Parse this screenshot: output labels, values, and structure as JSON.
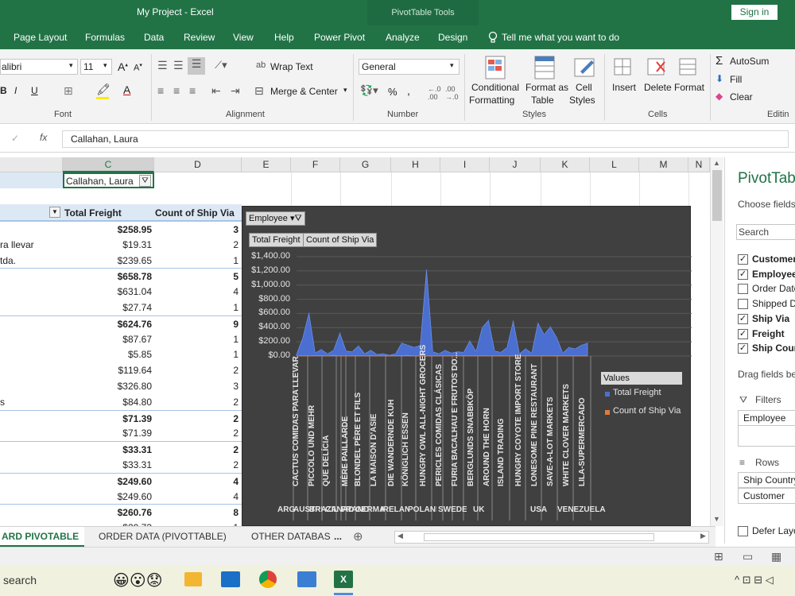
{
  "window": {
    "title": "My Project  -  Excel",
    "context_tab": "PivotTable Tools",
    "signin": "Sign in"
  },
  "tabs": [
    "Page Layout",
    "Formulas",
    "Data",
    "Review",
    "View",
    "Help",
    "Power Pivot",
    "Analyze",
    "Design"
  ],
  "tell_me": "Tell me what you want to do",
  "ribbon": {
    "font_name": "alibri",
    "font_size": "11",
    "wrap_text": "Wrap Text",
    "merge_center": "Merge & Center",
    "number_format": "General",
    "conditional": "Conditional",
    "formatting": "Formatting",
    "format_as": "Format as",
    "table": "Table",
    "cell": "Cell",
    "styles_btn": "Styles",
    "insert": "Insert",
    "delete": "Delete",
    "format": "Format",
    "autosum": "AutoSum",
    "fill": "Fill",
    "clear": "Clear",
    "groups": {
      "font": "Font",
      "alignment": "Alignment",
      "number": "Number",
      "styles": "Styles",
      "cells": "Cells",
      "editing": "Editin"
    }
  },
  "formula_bar": {
    "value": "Callahan, Laura"
  },
  "grid": {
    "columns": [
      "C",
      "D",
      "E",
      "F",
      "G",
      "H",
      "I",
      "J",
      "K",
      "L",
      "M",
      "N"
    ],
    "filter_value": "Callahan, Laura",
    "headers": {
      "freight": "Total Freight",
      "count": "Count of Ship Via"
    },
    "rows": [
      {
        "label": "",
        "freight": "$258.95",
        "count": "3",
        "bold": true
      },
      {
        "label": "ra llevar",
        "freight": "$19.31",
        "count": "2",
        "bold": false
      },
      {
        "label": "tda.",
        "freight": "$239.65",
        "count": "1",
        "bold": false
      },
      {
        "label": "",
        "freight": "$658.78",
        "count": "5",
        "bold": true
      },
      {
        "label": "",
        "freight": "$631.04",
        "count": "4",
        "bold": false
      },
      {
        "label": "",
        "freight": "$27.74",
        "count": "1",
        "bold": false
      },
      {
        "label": "",
        "freight": "$624.76",
        "count": "9",
        "bold": true
      },
      {
        "label": "",
        "freight": "$87.67",
        "count": "1",
        "bold": false
      },
      {
        "label": "",
        "freight": "$5.85",
        "count": "1",
        "bold": false
      },
      {
        "label": "",
        "freight": "$119.64",
        "count": "2",
        "bold": false
      },
      {
        "label": "",
        "freight": "$326.80",
        "count": "3",
        "bold": false
      },
      {
        "label": "s",
        "freight": "$84.80",
        "count": "2",
        "bold": false
      },
      {
        "label": "",
        "freight": "$71.39",
        "count": "2",
        "bold": true
      },
      {
        "label": "",
        "freight": "$71.39",
        "count": "2",
        "bold": false
      },
      {
        "label": "",
        "freight": "$33.31",
        "count": "2",
        "bold": true
      },
      {
        "label": "",
        "freight": "$33.31",
        "count": "2",
        "bold": false
      },
      {
        "label": "",
        "freight": "$249.60",
        "count": "4",
        "bold": true
      },
      {
        "label": "",
        "freight": "$249.60",
        "count": "4",
        "bold": false
      },
      {
        "label": "",
        "freight": "$260.76",
        "count": "8",
        "bold": true
      },
      {
        "label": "",
        "freight": "$20.73",
        "count": "1",
        "bold": false
      }
    ]
  },
  "chart_data": {
    "type": "area",
    "filter_button": "Employee",
    "field_buttons": [
      "Total Freight",
      "Count of Ship Via"
    ],
    "ylim": [
      0,
      1400
    ],
    "yticks": [
      "$1,400.00",
      "$1,200.00",
      "$1,000.00",
      "$800.00",
      "$600.00",
      "$400.00",
      "$200.00",
      "$0.00"
    ],
    "x_labels": [
      "CACTUS COMIDAS PARA LLEVAR",
      "PICCOLO UND MEHR",
      "QUE DELÍCIA",
      "MÈRE PAILLARDE",
      "BLONDEL PÈRE ET FILS",
      "LA MAISON D'ASIE",
      "DIE WANDERNDE KUH",
      "KÖNIGLICH ESSEN",
      "HUNGRY OWL ALL-NIGHT GROCERS",
      "PERICLES COMIDAS CLÁSICAS",
      "FURIA BACALHAU E FRUTOS DO...",
      "BERGLUNDS SNABBKÖP",
      "AROUND THE HORN",
      "ISLAND TRADING",
      "HUNGRY COYOTE IMPORT STORE",
      "LONESOME PINE RESTAURANT",
      "SAVE-A-LOT MARKETS",
      "WHITE CLOVER MARKETS",
      "LILA-SUPERMERCADO"
    ],
    "countries": [
      "ARG",
      "AUSTRIA",
      "BRAZIL",
      "CANADA",
      "FRANCE",
      "GERMANY",
      "IRELAND",
      "POLAND",
      "SWEDEN",
      "UK",
      "USA",
      "VENEZUELA"
    ],
    "legend_title": "Values",
    "series": [
      {
        "name": "Total Freight",
        "color": "#4a6fd1",
        "values": [
          20,
          250,
          600,
          40,
          90,
          30,
          80,
          320,
          70,
          60,
          140,
          30,
          80,
          20,
          30,
          10,
          30,
          180,
          150,
          120,
          150,
          1210,
          60,
          30,
          80,
          40,
          60,
          50,
          210,
          60,
          400,
          500,
          70,
          50,
          120,
          490,
          30,
          100,
          40,
          460,
          300,
          410,
          260,
          40,
          120,
          100,
          150,
          180
        ]
      },
      {
        "name": "Count of Ship Via",
        "color": "#e07b39",
        "values": [
          3,
          2,
          1,
          5,
          4,
          1,
          9,
          1,
          1,
          2,
          3,
          2,
          2,
          2,
          2,
          2,
          4,
          4,
          8,
          1,
          2,
          1,
          3,
          2,
          1,
          2,
          1,
          3,
          2,
          1,
          2,
          3,
          1,
          2,
          1,
          2,
          1,
          2,
          3,
          1,
          2,
          1,
          2,
          1,
          2,
          3,
          1,
          2
        ]
      }
    ]
  },
  "pane": {
    "title": "PivotTab",
    "choose": "Choose fields t",
    "search_placeholder": "Search",
    "fields": [
      {
        "label": "Customer",
        "checked": true,
        "bold": true
      },
      {
        "label": "Employee",
        "checked": true,
        "bold": true
      },
      {
        "label": "Order Date",
        "checked": false,
        "bold": false
      },
      {
        "label": "Shipped Da",
        "checked": false,
        "bold": false
      },
      {
        "label": "Ship Via",
        "checked": true,
        "bold": true
      },
      {
        "label": "Freight",
        "checked": true,
        "bold": true
      },
      {
        "label": "Ship Count",
        "checked": true,
        "bold": true
      }
    ],
    "drag_text": "Drag fields bet",
    "filters_label": "Filters",
    "filters_item": "Employee",
    "rows_label": "Rows",
    "rows_items": [
      "Ship Country",
      "Customer"
    ],
    "defer": "Defer Layo"
  },
  "sheets": {
    "active": "ARD PIVOTABLE",
    "tab2": "ORDER DATA (PIVOTTABLE)",
    "tab3": "OTHER DATABAS"
  },
  "taskbar": {
    "search": "search"
  }
}
